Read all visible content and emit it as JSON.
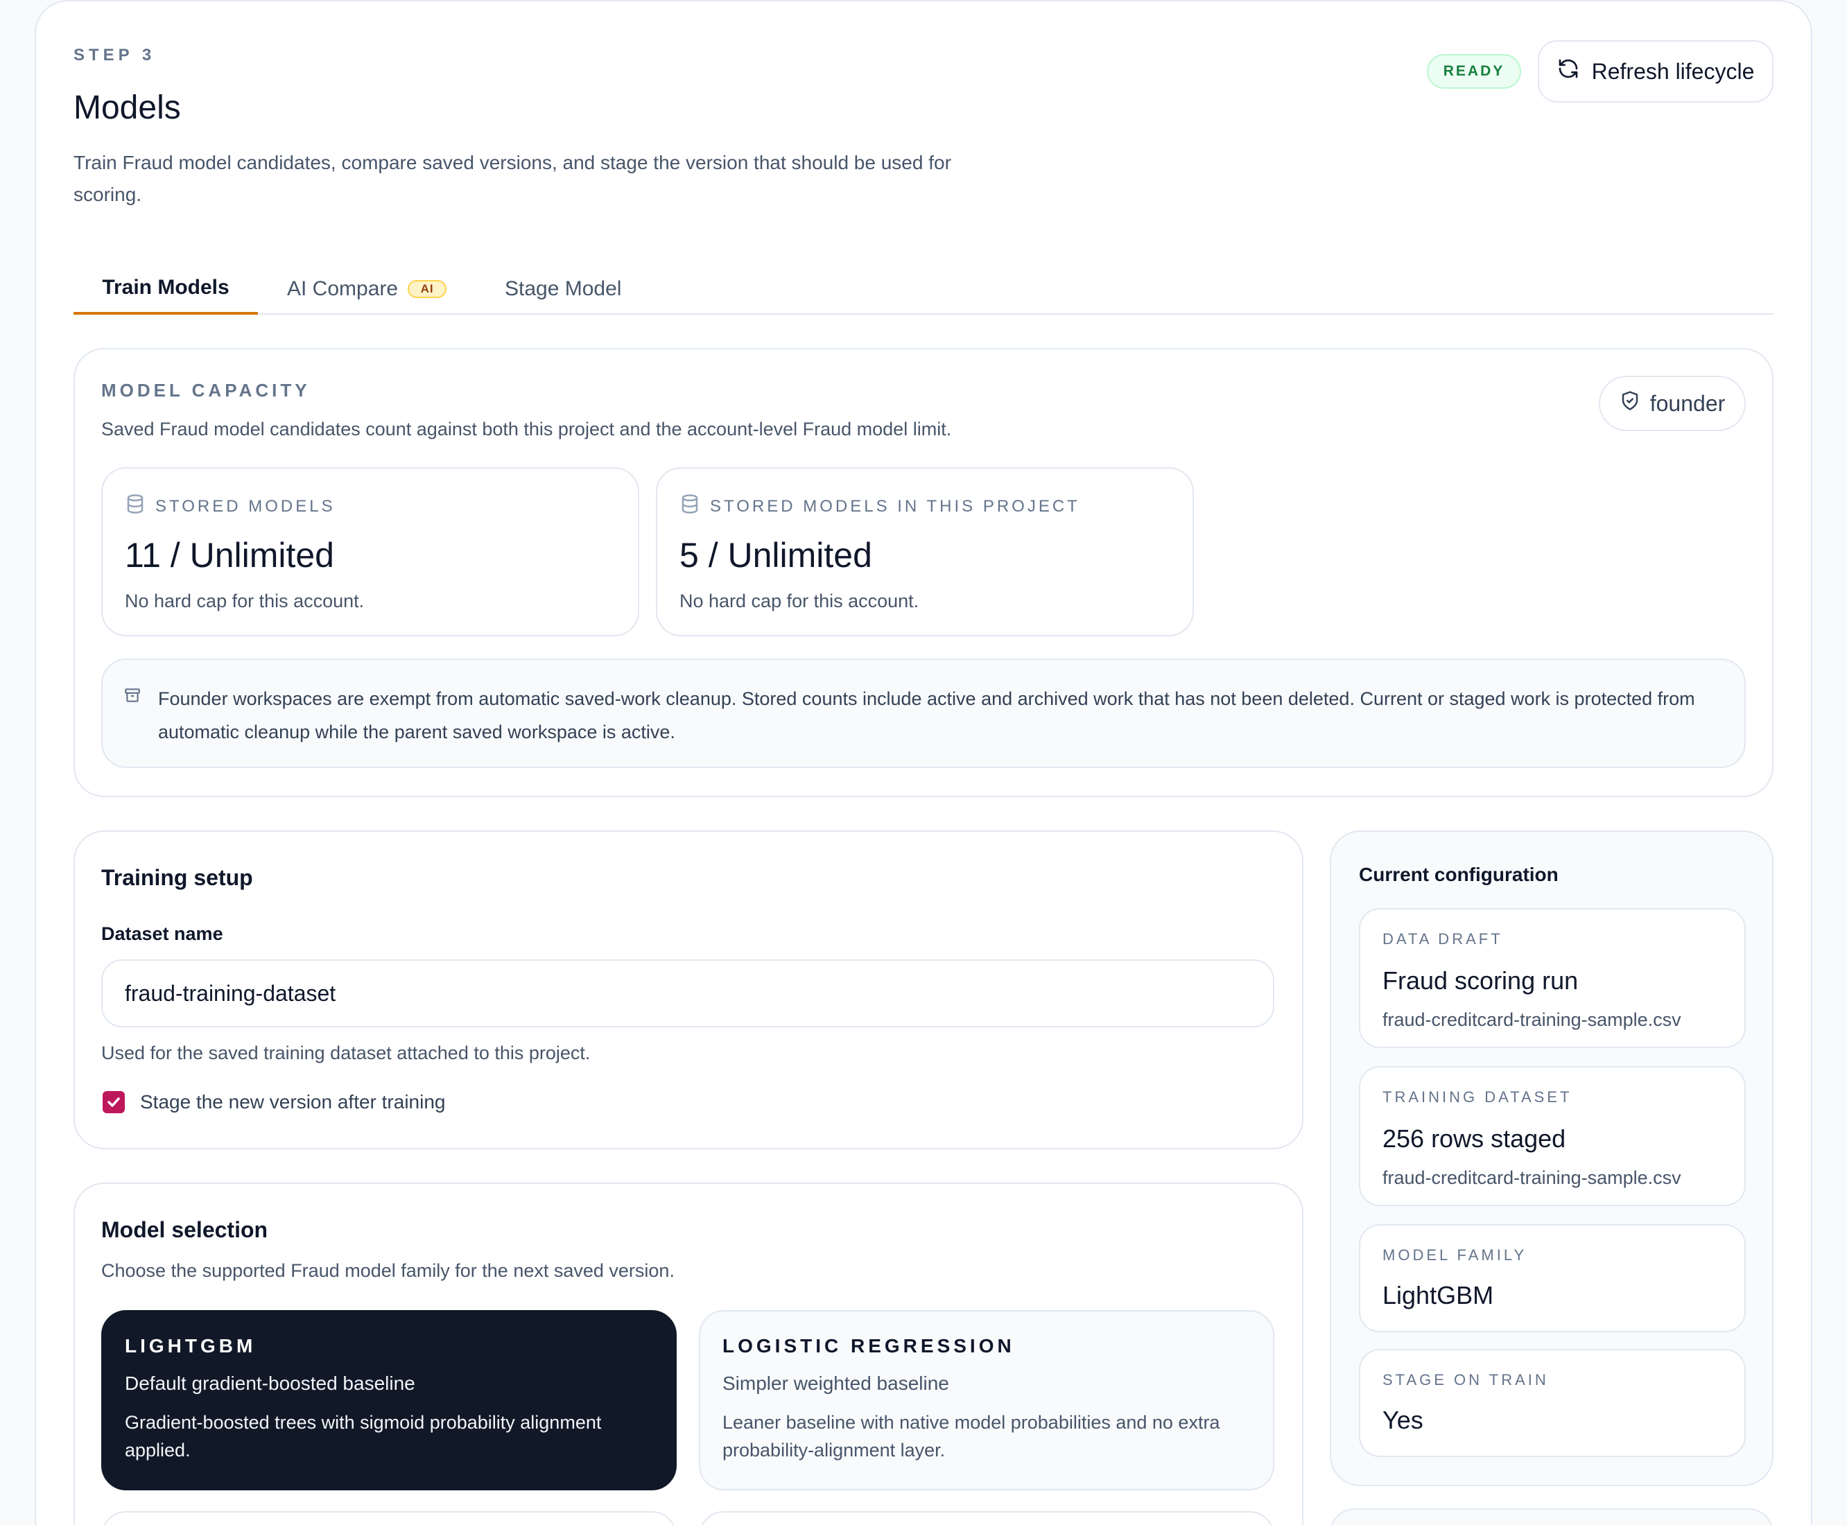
{
  "header": {
    "step": "STEP 3",
    "title": "Models",
    "description": "Train Fraud model candidates, compare saved versions, and stage the version that should be used for scoring.",
    "status_badge": "READY",
    "refresh_label": "Refresh lifecycle"
  },
  "tabs": [
    {
      "label": "Train Models",
      "active": true
    },
    {
      "label": "AI Compare",
      "badge": "AI",
      "active": false
    },
    {
      "label": "Stage Model",
      "active": false
    }
  ],
  "capacity": {
    "title": "MODEL CAPACITY",
    "description": "Saved Fraud model candidates count against both this project and the account-level Fraud model limit.",
    "role": "founder",
    "stats": [
      {
        "label": "STORED MODELS",
        "value": "11 / Unlimited",
        "note": "No hard cap for this account."
      },
      {
        "label": "STORED MODELS IN THIS PROJECT",
        "value": "5 / Unlimited",
        "note": "No hard cap for this account."
      }
    ],
    "info": "Founder workspaces are exempt from automatic saved-work cleanup. Stored counts include active and archived work that has not been deleted. Current or staged work is protected from automatic cleanup while the parent saved workspace is active."
  },
  "training_setup": {
    "title": "Training setup",
    "dataset_label": "Dataset name",
    "dataset_value": "fraud-training-dataset",
    "dataset_helper": "Used for the saved training dataset attached to this project.",
    "stage_checkbox_label": "Stage the new version after training",
    "stage_checked": true
  },
  "model_selection": {
    "title": "Model selection",
    "description": "Choose the supported Fraud model family for the next saved version.",
    "options": [
      {
        "name": "LIGHTGBM",
        "subtitle": "Default gradient-boosted baseline",
        "description": "Gradient-boosted trees with sigmoid probability alignment applied.",
        "selected": true
      },
      {
        "name": "LOGISTIC REGRESSION",
        "subtitle": "Simpler weighted baseline",
        "description": "Leaner baseline with native model probabilities and no extra probability-alignment layer.",
        "selected": false
      }
    ]
  },
  "current_configuration": {
    "title": "Current configuration",
    "items": [
      {
        "label": "DATA DRAFT",
        "value": "Fraud scoring run",
        "file": "fraud-creditcard-training-sample.csv"
      },
      {
        "label": "TRAINING DATASET",
        "value": "256 rows staged",
        "file": "fraud-creditcard-training-sample.csv"
      },
      {
        "label": "MODEL FAMILY",
        "value": "LightGBM"
      },
      {
        "label": "STAGE ON TRAIN",
        "value": "Yes"
      }
    ]
  },
  "colors": {
    "accent_tab": "#d97706",
    "checkbox": "#be185d",
    "selected_card": "#111827",
    "ready_badge": "#15803d"
  }
}
